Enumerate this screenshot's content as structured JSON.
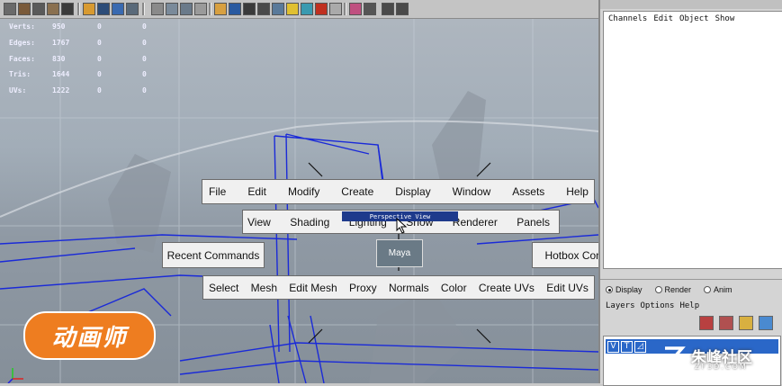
{
  "stats": {
    "rows": [
      {
        "label": "Verts:",
        "v1": "950",
        "v2": "0",
        "v3": "0"
      },
      {
        "label": "Edges:",
        "v1": "1767",
        "v2": "0",
        "v3": "0"
      },
      {
        "label": "Faces:",
        "v1": "830",
        "v2": "0",
        "v3": "0"
      },
      {
        "label": "Tris:",
        "v1": "1644",
        "v2": "0",
        "v3": "0"
      },
      {
        "label": "UVs:",
        "v1": "1222",
        "v2": "0",
        "v3": "0"
      }
    ]
  },
  "hotbox": {
    "top_row": [
      "File",
      "Edit",
      "Modify",
      "Create",
      "Display",
      "Window",
      "Assets",
      "Help"
    ],
    "view_row": [
      "View",
      "Shading",
      "Lighting",
      "Show",
      "Renderer",
      "Panels"
    ],
    "bottom_row": [
      "Select",
      "Mesh",
      "Edit Mesh",
      "Proxy",
      "Normals",
      "Color",
      "Create UVs",
      "Edit UVs"
    ],
    "recent_commands": "Recent Commands",
    "hotbox_controls": "Hotbox Controls",
    "center": "Maya",
    "highlight": "Perspective View"
  },
  "channel_box": {
    "menu": [
      "Channels",
      "Edit",
      "Object",
      "Show"
    ]
  },
  "layer_editor": {
    "radios": [
      {
        "label": "Display",
        "selected": true
      },
      {
        "label": "Render",
        "selected": false
      },
      {
        "label": "Anim",
        "selected": false
      }
    ],
    "menu": [
      "Layers",
      "Options",
      "Help"
    ],
    "row": {
      "v": "V",
      "t": "T"
    }
  },
  "watermark": {
    "logo_text": "动画师",
    "site_name": "朱峰社区",
    "site_url": "ZF3D.COM"
  },
  "colors": {
    "hotbox_bg": "#f0f0f0",
    "highlight_bg": "#1e3a8c",
    "logo_orange": "#ee7d20",
    "layer_selected": "#2a67c8"
  }
}
